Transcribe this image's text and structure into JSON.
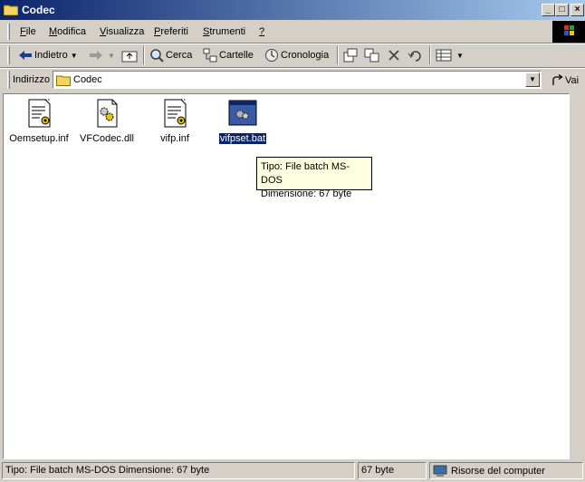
{
  "window": {
    "title": "Codec"
  },
  "menu": [
    "File",
    "Modifica",
    "Visualizza",
    "Preferiti",
    "Strumenti",
    "?"
  ],
  "menu_underline": [
    "F",
    "M",
    "V",
    "P",
    "S",
    "?"
  ],
  "toolbar": {
    "back_label": "Indietro",
    "search_label": "Cerca",
    "folders_label": "Cartelle",
    "history_label": "Cronologia"
  },
  "address": {
    "label": "Indirizzo",
    "value": "Codec",
    "go_label": "Vai"
  },
  "files": [
    {
      "name": "Oemsetup.inf",
      "icon": "inf-file-icon"
    },
    {
      "name": "VFCodec.dll",
      "icon": "dll-file-icon"
    },
    {
      "name": "vifp.inf",
      "icon": "inf-file-icon"
    },
    {
      "name": "vifpset.bat",
      "icon": "bat-file-icon",
      "selected": true
    }
  ],
  "tooltip": {
    "line1": "Tipo: File batch MS-DOS",
    "line2": "Dimensione: 67 byte"
  },
  "status": {
    "text": "Tipo: File batch MS-DOS Dimensione: 67 byte",
    "size": "67 byte",
    "zone": "Risorse del computer"
  }
}
